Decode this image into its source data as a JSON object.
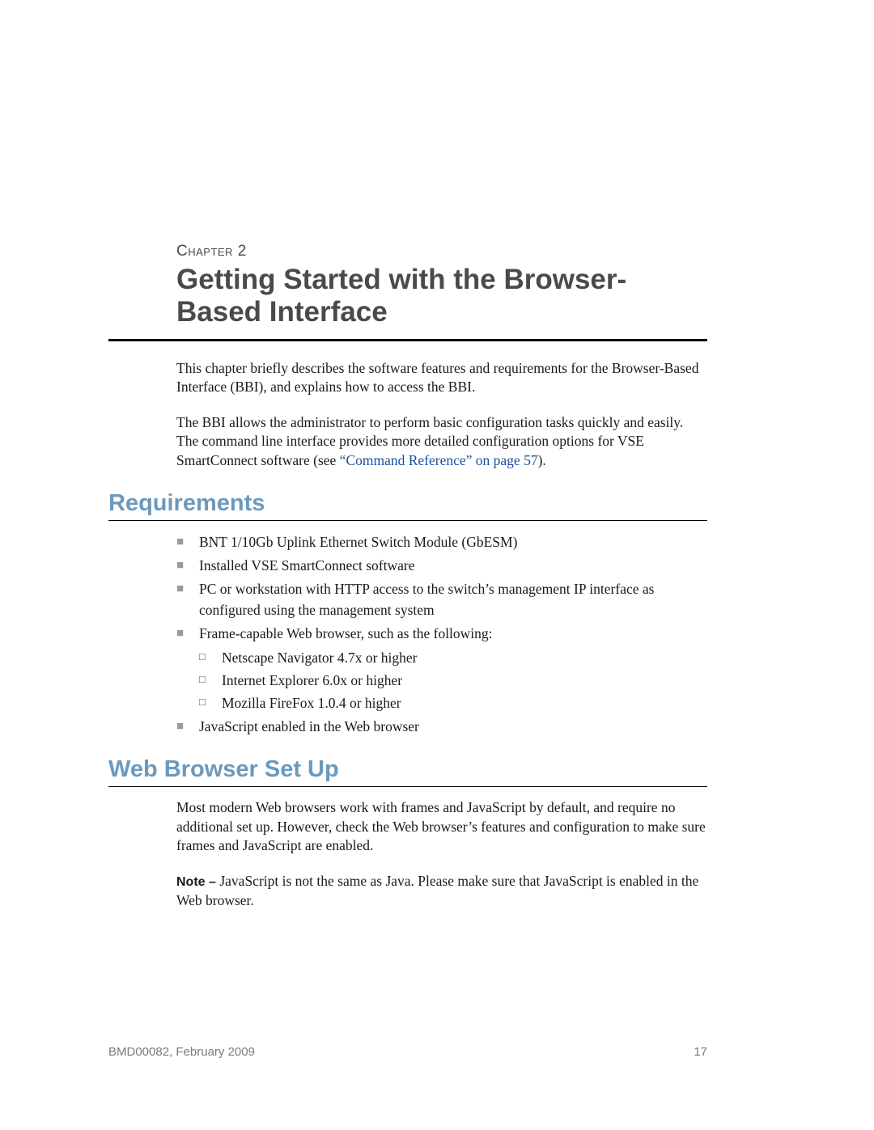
{
  "chapter_label": "Chapter 2",
  "chapter_title": "Getting Started with the Browser-Based Interface",
  "intro_para_1": "This chapter briefly describes the software features and requirements for the Browser-Based Interface (BBI), and explains how to access the BBI.",
  "intro_para_2a": "The BBI allows the administrator to perform basic configuration tasks quickly and easily. The command line interface provides more detailed configuration options for VSE SmartConnect software (see ",
  "intro_link_text": "“Command Reference” on page 57",
  "intro_para_2b": ").",
  "requirements": {
    "heading": "Requirements",
    "items": [
      "BNT 1/10Gb Uplink Ethernet Switch Module (GbESM)",
      "Installed VSE SmartConnect software",
      "PC or workstation with HTTP access to the switch’s management IP interface as configured using the management system",
      "Frame-capable Web browser, such as the following:",
      "JavaScript enabled in the Web browser"
    ],
    "sub_items": [
      "Netscape Navigator 4.7x or higher",
      "Internet Explorer 6.0x or higher",
      "Mozilla FireFox 1.0.4 or higher"
    ]
  },
  "web_browser": {
    "heading": "Web Browser Set Up",
    "para": "Most modern Web browsers work with frames and JavaScript by default, and require no additional set up. However, check the Web browser’s features and configuration to make sure frames and JavaScript are enabled.",
    "note_lead": "Note – ",
    "note_body": "JavaScript is not the same as Java. Please make sure that JavaScript is enabled in the Web browser."
  },
  "footer": {
    "left": "BMD00082, February 2009",
    "right": "17"
  }
}
